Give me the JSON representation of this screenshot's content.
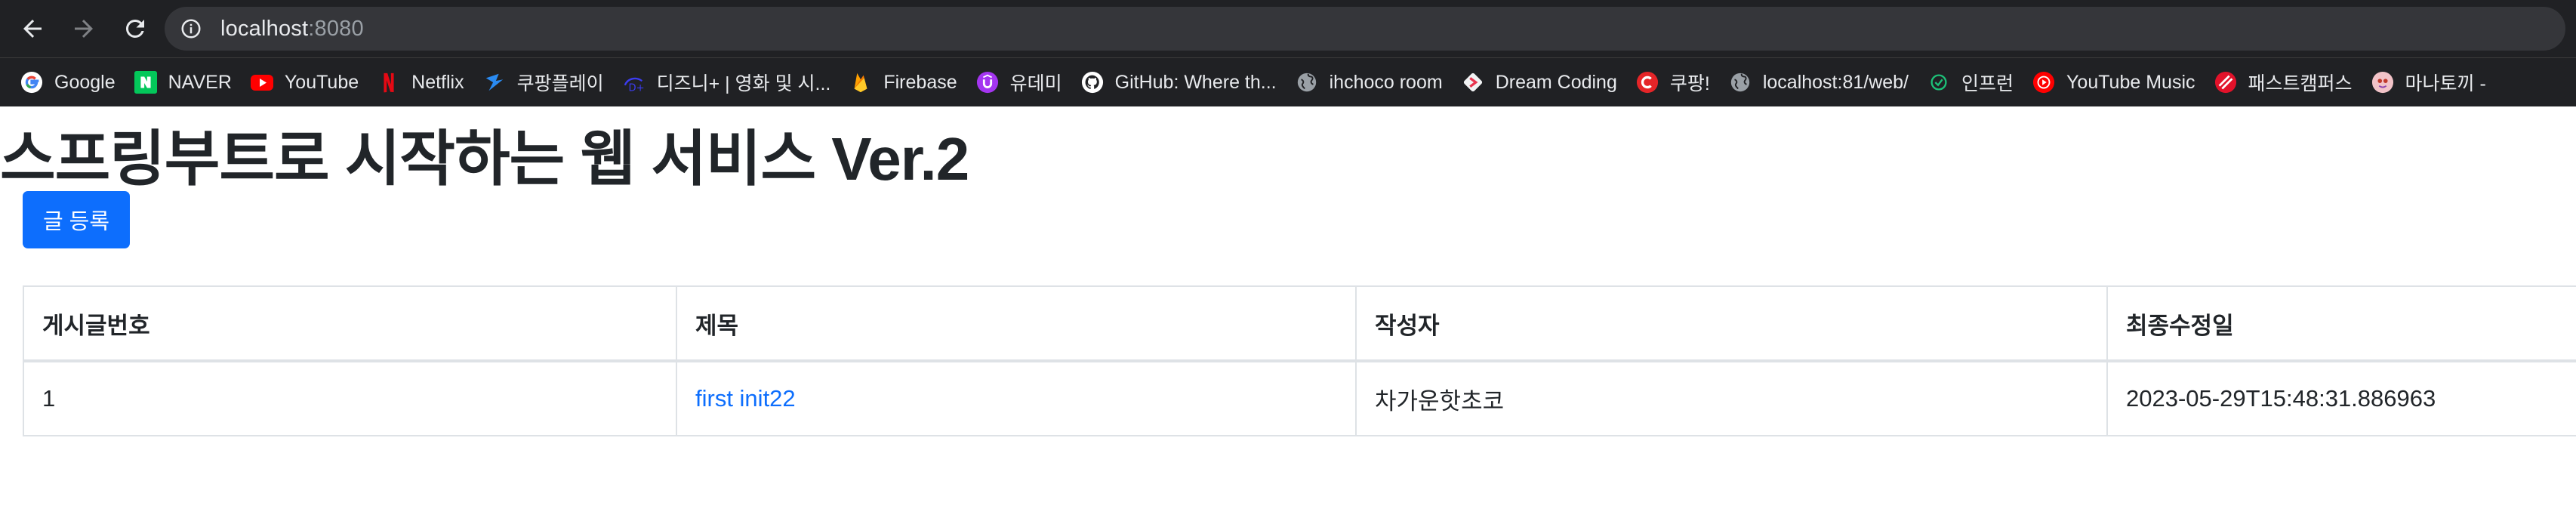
{
  "browser": {
    "url_host": "localhost",
    "url_port": ":8080",
    "bookmarks": [
      {
        "label": "Google",
        "icon": "google-icon"
      },
      {
        "label": "NAVER",
        "icon": "naver-icon"
      },
      {
        "label": "YouTube",
        "icon": "youtube-icon"
      },
      {
        "label": "Netflix",
        "icon": "netflix-icon"
      },
      {
        "label": "쿠팡플레이",
        "icon": "coupang-play-icon"
      },
      {
        "label": "디즈니+ | 영화 및 시...",
        "icon": "disney-plus-icon"
      },
      {
        "label": "Firebase",
        "icon": "firebase-icon"
      },
      {
        "label": "유데미",
        "icon": "udemy-icon"
      },
      {
        "label": "GitHub: Where th...",
        "icon": "github-icon"
      },
      {
        "label": "ihchoco room",
        "icon": "globe-icon"
      },
      {
        "label": "Dream Coding",
        "icon": "dream-coding-icon"
      },
      {
        "label": "쿠팡!",
        "icon": "coupang-icon"
      },
      {
        "label": "localhost:81/web/",
        "icon": "globe-icon"
      },
      {
        "label": "인프런",
        "icon": "inflearn-icon"
      },
      {
        "label": "YouTube Music",
        "icon": "youtube-music-icon"
      },
      {
        "label": "패스트캠퍼스",
        "icon": "fastcampus-icon"
      },
      {
        "label": "마나토끼 -",
        "icon": "manatoki-icon"
      }
    ]
  },
  "page": {
    "title": "스프링부트로 시작하는 웹 서비스 Ver.2",
    "register_button": "글 등록",
    "table": {
      "headers": [
        "게시글번호",
        "제목",
        "작성자",
        "최종수정일"
      ],
      "rows": [
        {
          "id": "1",
          "title": "first init22",
          "author": "차가운핫초코",
          "modified": "2023-05-29T15:48:31.886963"
        }
      ]
    }
  },
  "colors": {
    "chrome_bg": "#202124",
    "omnibox_bg": "#35363a",
    "primary": "#0d6efd",
    "table_border": "#dee2e6"
  }
}
